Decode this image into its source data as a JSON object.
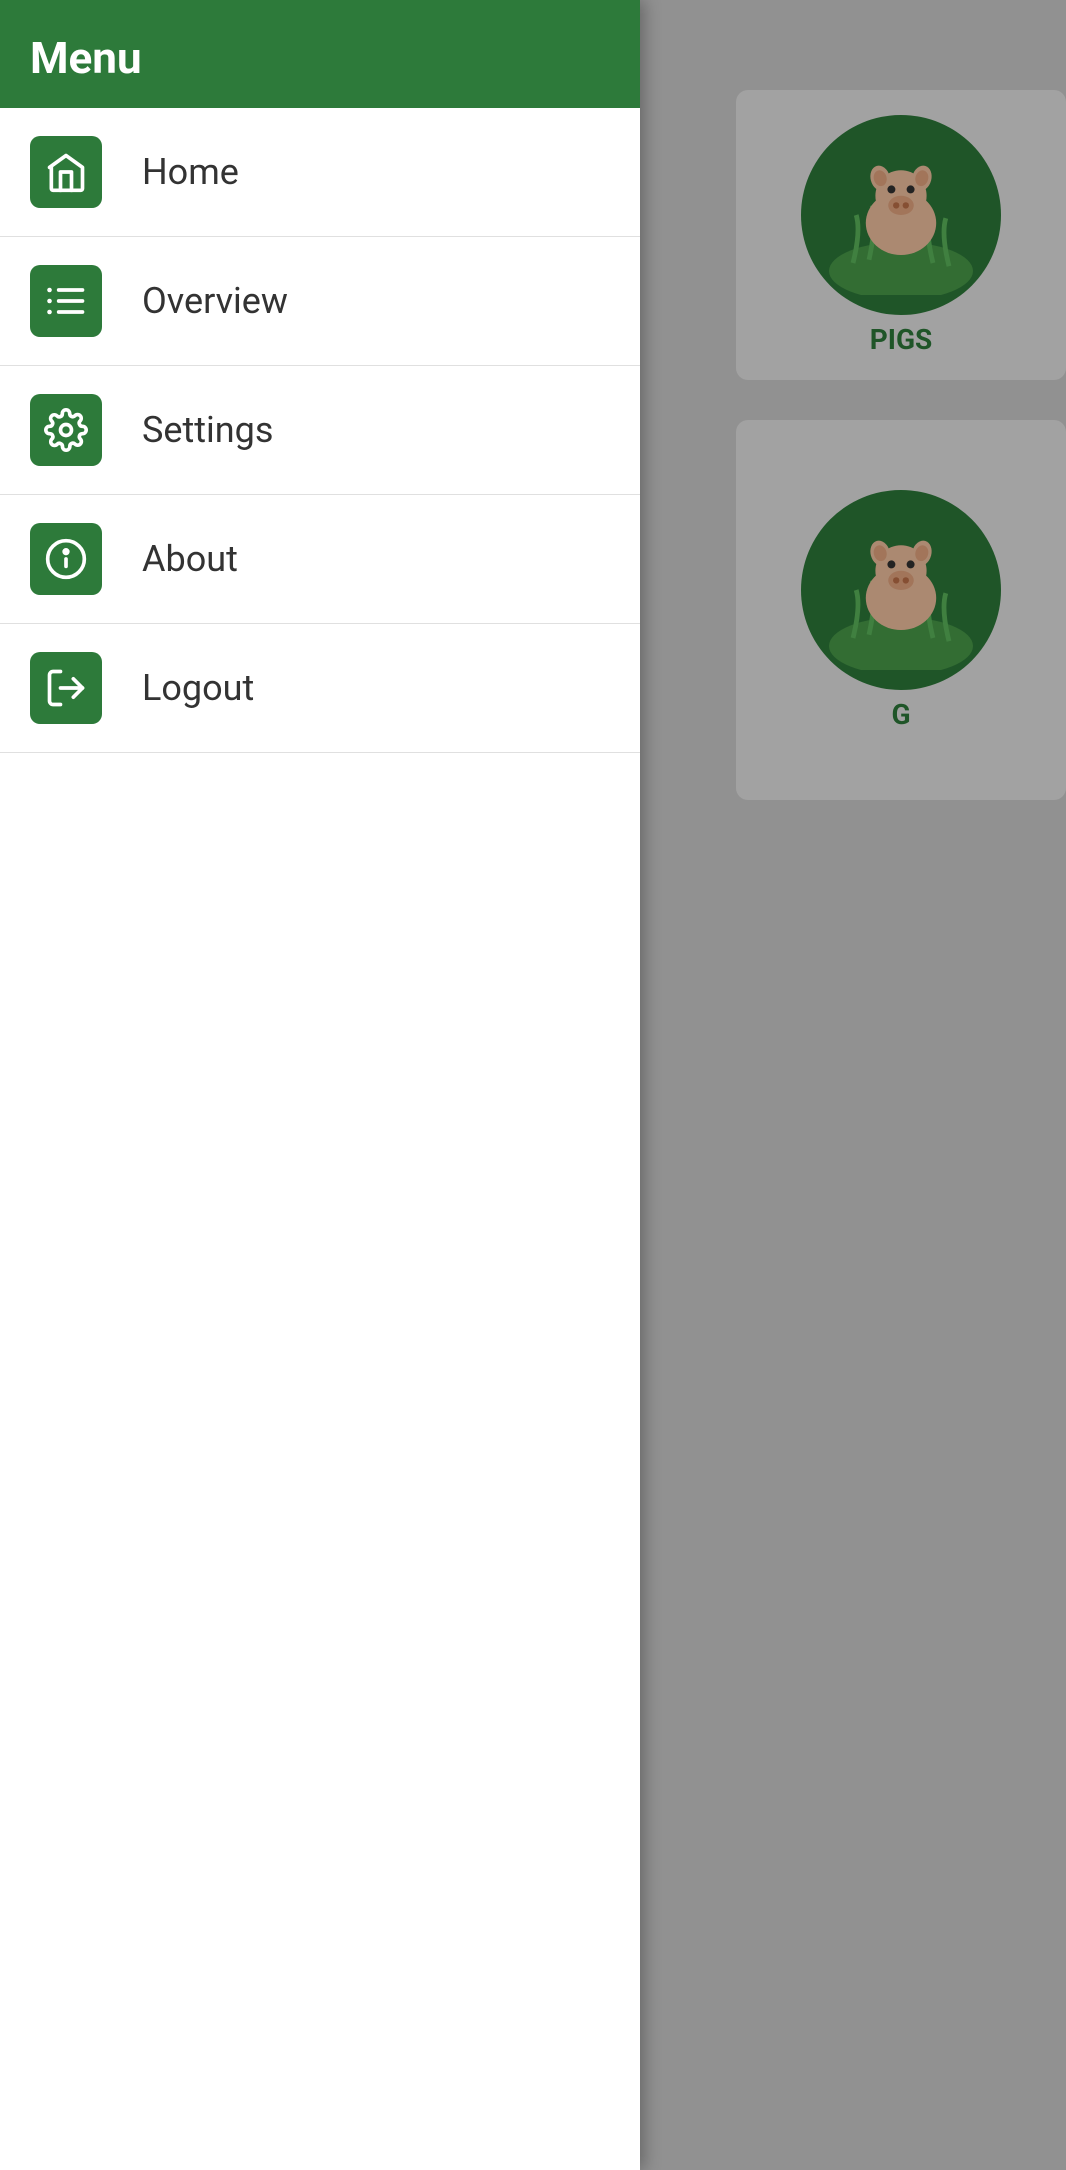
{
  "colors": {
    "green": "#2d7a3a",
    "white": "#ffffff",
    "text_dark": "#333333",
    "divider": "#e0e0e0",
    "bg_gray": "#d0d0d0"
  },
  "menu": {
    "title": "Menu",
    "items": [
      {
        "id": "home",
        "label": "Home",
        "icon": "home-icon"
      },
      {
        "id": "overview",
        "label": "Overview",
        "icon": "list-icon"
      },
      {
        "id": "settings",
        "label": "Settings",
        "icon": "gear-icon"
      },
      {
        "id": "about",
        "label": "About",
        "icon": "info-icon"
      },
      {
        "id": "logout",
        "label": "Logout",
        "icon": "logout-icon"
      }
    ]
  },
  "background": {
    "card1_text": "PIGS",
    "card2_text": "G"
  }
}
